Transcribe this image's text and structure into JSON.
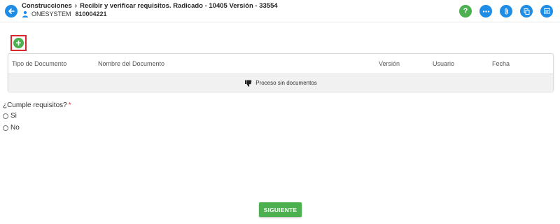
{
  "header": {
    "breadcrumb_root": "Construcciones",
    "breadcrumb_current": "Recibir y verificar requisitos. Radicado - 10405 Versión - 33554",
    "user_name": "ONESYSTEM",
    "user_code": "810004221",
    "icons": [
      "help-icon",
      "more-icon",
      "attachment-icon",
      "copy-icon",
      "comments-icon"
    ]
  },
  "table": {
    "columns": [
      "Tipo de Documento",
      "Nombre del Documento",
      "Versión",
      "Usuario",
      "Fecha"
    ],
    "empty_message": "Proceso sin documentos"
  },
  "form": {
    "question": "¿Cumple requisitos?",
    "required_mark": "*",
    "options": [
      "Si",
      "No"
    ]
  },
  "actions": {
    "next_label": "SIGUIENTE"
  },
  "colors": {
    "primary": "#1f8ce6",
    "success": "#4caf50",
    "highlight": "#d9262c",
    "required": "#e53935"
  }
}
